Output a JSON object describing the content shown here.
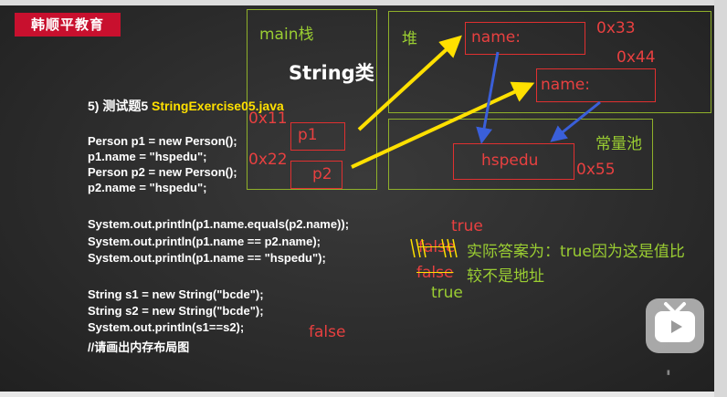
{
  "logo": "韩顺平教育",
  "regions": {
    "stack": "main栈",
    "heap": "堆",
    "pool": "常量池"
  },
  "title": "String类",
  "exercise": {
    "prefix": "5) 测试题5 ",
    "name": "StringExercise05.java"
  },
  "code": [
    "Person p1 = new Person();",
    "p1.name = \"hspedu\";",
    "Person p2 = new Person();",
    "p2.name = \"hspedu\";",
    "System.out.println(p1.name.equals(p2.name));",
    "System.out.println(p1.name == p2.name);",
    "System.out.println(p1.name == \"hspedu\");",
    "String s1 = new String(\"bcde\");",
    "String s2 = new String(\"bcde\");",
    "System.out.println(s1==s2);",
    "//请画出内存布局图"
  ],
  "memory": {
    "p1": "p1",
    "p2": "p2",
    "addr_p1": "0x11",
    "addr_p2": "0x22",
    "obj1": "name:",
    "obj2": "name:",
    "addr_obj1": "0x33",
    "addr_obj2": "0x44",
    "pool_value": "hspedu",
    "addr_pool": "0x55"
  },
  "answers": {
    "a1": "true",
    "a2_struck": "false",
    "a2_note1": "实际答案为：true因为这是值比",
    "a3_struck": "false",
    "a2_note2": "较不是地址",
    "a3": "true",
    "a4": "false"
  },
  "colors": {
    "red": "#e84040",
    "green": "#9acd32",
    "yellow": "#ffe000",
    "blue": "#3a5fd9"
  }
}
